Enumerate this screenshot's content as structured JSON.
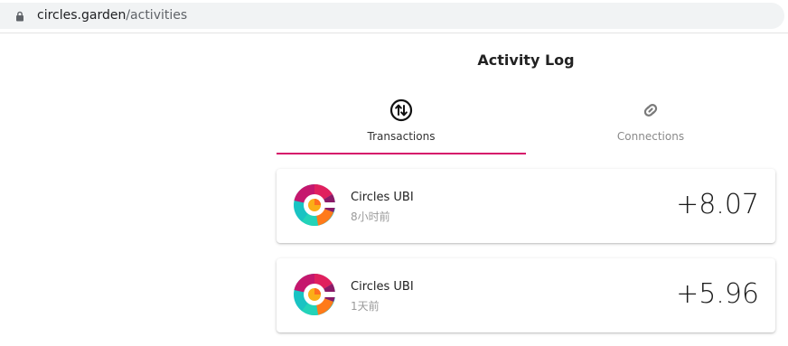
{
  "browser": {
    "url_domain": "circles.garden",
    "url_path": "/activities"
  },
  "page": {
    "title": "Activity Log"
  },
  "tabs": [
    {
      "label": "Transactions",
      "icon": "transactions-arrows-icon",
      "active": true
    },
    {
      "label": "Connections",
      "icon": "link-icon",
      "active": false
    }
  ],
  "activities": [
    {
      "title": "Circles UBI",
      "time": "8小时前",
      "amount": "+8.07",
      "avatar": "circles-logo"
    },
    {
      "title": "Circles UBI",
      "time": "1天前",
      "amount": "+5.96",
      "avatar": "circles-logo"
    }
  ],
  "colors": {
    "accent": "#d6146a"
  }
}
